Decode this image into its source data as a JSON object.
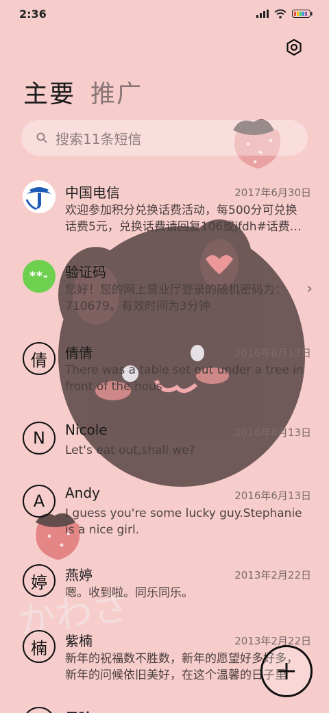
{
  "status_bar": {
    "time": "2:36",
    "icons": [
      "signal-icon",
      "wifi-icon",
      "battery-icon"
    ]
  },
  "header": {
    "settings_icon": "gear-icon",
    "tabs": [
      {
        "label": "主要",
        "active": true
      },
      {
        "label": "推广",
        "active": false
      }
    ]
  },
  "search": {
    "placeholder": "搜索11条短信",
    "icon": "search-icon"
  },
  "messages": [
    {
      "sender": "中国电信",
      "date": "2017年6月30日",
      "preview": "欢迎参加积分兑换话费活动，每500分可兑换话费5元，兑换话费请回复106或jfdh#话费…",
      "avatar_type": "logo"
    },
    {
      "sender": "验证码",
      "date": "",
      "preview": "您好！您的网上营业厅登录的随机密码为：710679。有效时间为3分钟",
      "avatar_text": "**-"
    },
    {
      "sender": "倩倩",
      "date": "2016年6月13日",
      "preview": "There was a table set out under a tree in front of the hous",
      "avatar_text": "倩"
    },
    {
      "sender": "Nicole",
      "date": "2016年6月13日",
      "preview": "Let's eat out,shall we?",
      "avatar_text": "N"
    },
    {
      "sender": "Andy",
      "date": "2016年6月13日",
      "preview": "I guess you're some lucky guy.Stephanie is a nice girl.",
      "avatar_text": "A"
    },
    {
      "sender": "燕婷",
      "date": "2013年2月22日",
      "preview": "嗯。收到啦。同乐同乐。",
      "avatar_text": "婷"
    },
    {
      "sender": "紫楠",
      "date": "2013年2月22日",
      "preview": "新年的祝福数不胜数，新年的愿望好多好多，新年的问候依旧美好，在这个温馨的日子里",
      "avatar_text": "楠"
    },
    {
      "sender": "子玲",
      "date": "",
      "preview": "",
      "avatar_text": ""
    }
  ],
  "fab": {
    "label": "+",
    "icon": "plus-icon"
  },
  "watermark_text": "かわさ"
}
